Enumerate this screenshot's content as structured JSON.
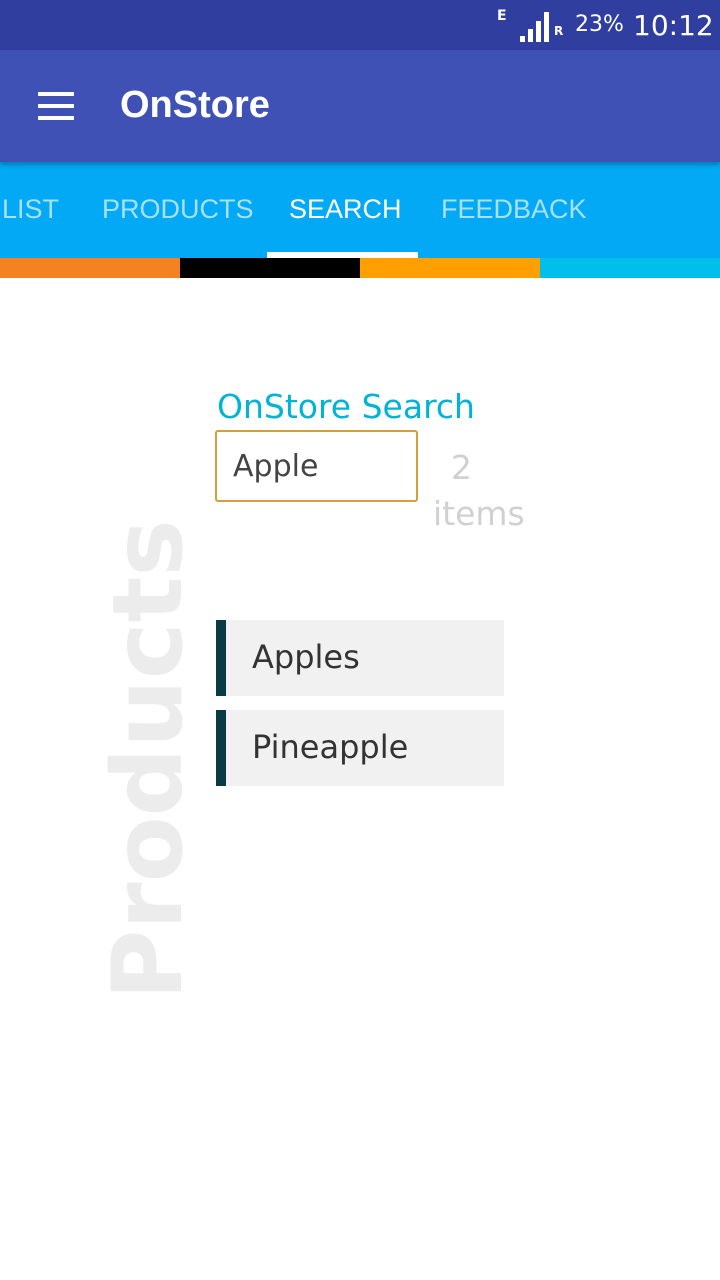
{
  "status_bar": {
    "network_type": "E",
    "roaming_indicator": "R",
    "battery": "23%",
    "time": "10:12"
  },
  "app_bar": {
    "title": "OnStore",
    "menu_icon": "hamburger-menu-icon"
  },
  "tabs": [
    {
      "label": "LIST",
      "active": false
    },
    {
      "label": "PRODUCTS",
      "active": false
    },
    {
      "label": "SEARCH",
      "active": true
    },
    {
      "label": "FEEDBACK",
      "active": false
    }
  ],
  "color_stripe": [
    "#f58220",
    "#000000",
    "#ffa000",
    "#00bfeb"
  ],
  "search": {
    "label": "OnStore Search",
    "value": "Apple",
    "result_count": "2",
    "result_unit": "items"
  },
  "side_label": "Products",
  "results": [
    {
      "name": "Apples"
    },
    {
      "name": "Pineapple"
    }
  ],
  "colors": {
    "status_bar": "#303f9f",
    "app_bar": "#3f51b5",
    "tab_bar": "#03a9f4",
    "search_label": "#00b4d8",
    "input_border": "#d2a03c",
    "result_accent": "#0a3a43"
  }
}
